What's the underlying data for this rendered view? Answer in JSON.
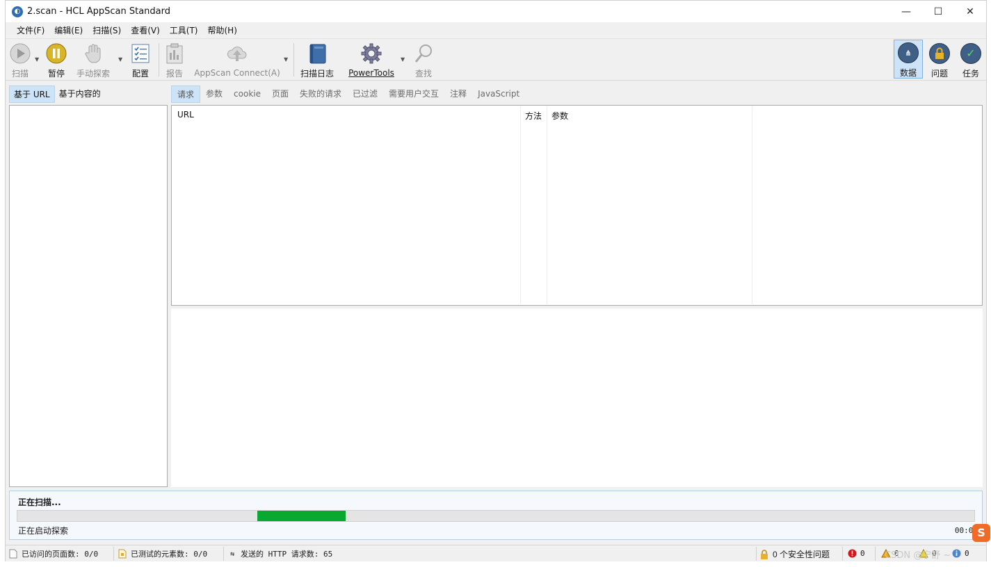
{
  "window": {
    "title": "2.scan - HCL AppScan Standard"
  },
  "menu": [
    {
      "label": "文件(F)"
    },
    {
      "label": "编辑(E)"
    },
    {
      "label": "扫描(S)"
    },
    {
      "label": "查看(V)"
    },
    {
      "label": "工具(T)"
    },
    {
      "label": "帮助(H)"
    }
  ],
  "toolbar": {
    "scan": "扫描",
    "pause": "暂停",
    "manual_explore": "手动探索",
    "config": "配置",
    "report": "报告",
    "appscan_connect": "AppScan Connect(A)",
    "scan_log": "扫描日志",
    "powertools": "PowerTools",
    "find": "查找",
    "data": "数据",
    "issues": "问题",
    "tasks": "任务"
  },
  "left_tabs": [
    {
      "label": "基于 URL",
      "active": true
    },
    {
      "label": "基于内容的",
      "active": false
    }
  ],
  "right_tabs": [
    {
      "label": "请求"
    },
    {
      "label": "参数"
    },
    {
      "label": "cookie"
    },
    {
      "label": "页面"
    },
    {
      "label": "失败的请求"
    },
    {
      "label": "已过滤"
    },
    {
      "label": "需要用户交互"
    },
    {
      "label": "注释"
    },
    {
      "label": "JavaScript"
    }
  ],
  "grid": {
    "columns": [
      "URL",
      "方法",
      "参数"
    ]
  },
  "progress": {
    "title": "正在扫描...",
    "status": "正在启动探索",
    "time": "00:02",
    "fill_start": 0.251,
    "fill_end": 0.343,
    "color": "#09a82f"
  },
  "statusbar": {
    "visited": "已访问的页面数: 0/0",
    "tested": "已测试的元素数: 0/0",
    "http": "发送的 HTTP 请求数: 65",
    "security": "0 个安全性问题",
    "high": "0",
    "medium": "0",
    "low": "0",
    "info": "0"
  },
  "watermark": "CSDN @宁舒 ~",
  "ime": "S"
}
